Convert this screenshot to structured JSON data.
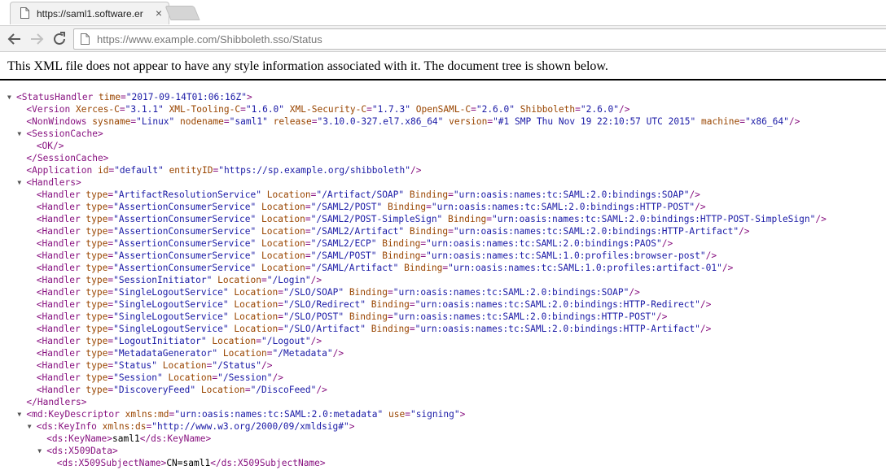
{
  "browser": {
    "tab_title": "https://saml1.software.er",
    "tab_close_glyph": "×",
    "url": "https://www.example.com/Shibboleth.sso/Status"
  },
  "notice": "This XML file does not appear to have any style information associated with it. The document tree is shown below.",
  "xml_lines": [
    {
      "indent": 0,
      "toggle": "open",
      "parts": [
        [
          "t",
          "<StatusHandler "
        ],
        [
          "n",
          "time"
        ],
        [
          "t",
          "="
        ],
        [
          "v",
          "\"2017-09-14T01:06:16Z\""
        ],
        [
          "t",
          ">"
        ]
      ]
    },
    {
      "indent": 1,
      "parts": [
        [
          "t",
          "<Version "
        ],
        [
          "n",
          "Xerces-C"
        ],
        [
          "t",
          "="
        ],
        [
          "v",
          "\"3.1.1\""
        ],
        [
          "x",
          " "
        ],
        [
          "n",
          "XML-Tooling-C"
        ],
        [
          "t",
          "="
        ],
        [
          "v",
          "\"1.6.0\""
        ],
        [
          "x",
          " "
        ],
        [
          "n",
          "XML-Security-C"
        ],
        [
          "t",
          "="
        ],
        [
          "v",
          "\"1.7.3\""
        ],
        [
          "x",
          " "
        ],
        [
          "n",
          "OpenSAML-C"
        ],
        [
          "t",
          "="
        ],
        [
          "v",
          "\"2.6.0\""
        ],
        [
          "x",
          " "
        ],
        [
          "n",
          "Shibboleth"
        ],
        [
          "t",
          "="
        ],
        [
          "v",
          "\"2.6.0\""
        ],
        [
          "t",
          "/>"
        ]
      ]
    },
    {
      "indent": 1,
      "parts": [
        [
          "t",
          "<NonWindows "
        ],
        [
          "n",
          "sysname"
        ],
        [
          "t",
          "="
        ],
        [
          "v",
          "\"Linux\""
        ],
        [
          "x",
          " "
        ],
        [
          "n",
          "nodename"
        ],
        [
          "t",
          "="
        ],
        [
          "v",
          "\"saml1\""
        ],
        [
          "x",
          " "
        ],
        [
          "n",
          "release"
        ],
        [
          "t",
          "="
        ],
        [
          "v",
          "\"3.10.0-327.el7.x86_64\""
        ],
        [
          "x",
          " "
        ],
        [
          "n",
          "version"
        ],
        [
          "t",
          "="
        ],
        [
          "v",
          "\"#1 SMP Thu Nov 19 22:10:57 UTC 2015\""
        ],
        [
          "x",
          " "
        ],
        [
          "n",
          "machine"
        ],
        [
          "t",
          "="
        ],
        [
          "v",
          "\"x86_64\""
        ],
        [
          "t",
          "/>"
        ]
      ]
    },
    {
      "indent": 1,
      "toggle": "open",
      "parts": [
        [
          "t",
          "<SessionCache>"
        ]
      ]
    },
    {
      "indent": 2,
      "parts": [
        [
          "t",
          "<OK/>"
        ]
      ]
    },
    {
      "indent": 1,
      "parts": [
        [
          "t",
          "</SessionCache>"
        ]
      ]
    },
    {
      "indent": 1,
      "parts": [
        [
          "t",
          "<Application "
        ],
        [
          "n",
          "id"
        ],
        [
          "t",
          "="
        ],
        [
          "v",
          "\"default\""
        ],
        [
          "x",
          " "
        ],
        [
          "n",
          "entityID"
        ],
        [
          "t",
          "="
        ],
        [
          "v",
          "\"https://sp.example.org/shibboleth\""
        ],
        [
          "t",
          "/>"
        ]
      ]
    },
    {
      "indent": 1,
      "toggle": "open",
      "parts": [
        [
          "t",
          "<Handlers>"
        ]
      ]
    },
    {
      "indent": 2,
      "parts": [
        [
          "t",
          "<Handler "
        ],
        [
          "n",
          "type"
        ],
        [
          "t",
          "="
        ],
        [
          "v",
          "\"ArtifactResolutionService\""
        ],
        [
          "x",
          " "
        ],
        [
          "n",
          "Location"
        ],
        [
          "t",
          "="
        ],
        [
          "v",
          "\"/Artifact/SOAP\""
        ],
        [
          "x",
          " "
        ],
        [
          "n",
          "Binding"
        ],
        [
          "t",
          "="
        ],
        [
          "v",
          "\"urn:oasis:names:tc:SAML:2.0:bindings:SOAP\""
        ],
        [
          "t",
          "/>"
        ]
      ]
    },
    {
      "indent": 2,
      "parts": [
        [
          "t",
          "<Handler "
        ],
        [
          "n",
          "type"
        ],
        [
          "t",
          "="
        ],
        [
          "v",
          "\"AssertionConsumerService\""
        ],
        [
          "x",
          " "
        ],
        [
          "n",
          "Location"
        ],
        [
          "t",
          "="
        ],
        [
          "v",
          "\"/SAML2/POST\""
        ],
        [
          "x",
          " "
        ],
        [
          "n",
          "Binding"
        ],
        [
          "t",
          "="
        ],
        [
          "v",
          "\"urn:oasis:names:tc:SAML:2.0:bindings:HTTP-POST\""
        ],
        [
          "t",
          "/>"
        ]
      ]
    },
    {
      "indent": 2,
      "parts": [
        [
          "t",
          "<Handler "
        ],
        [
          "n",
          "type"
        ],
        [
          "t",
          "="
        ],
        [
          "v",
          "\"AssertionConsumerService\""
        ],
        [
          "x",
          " "
        ],
        [
          "n",
          "Location"
        ],
        [
          "t",
          "="
        ],
        [
          "v",
          "\"/SAML2/POST-SimpleSign\""
        ],
        [
          "x",
          " "
        ],
        [
          "n",
          "Binding"
        ],
        [
          "t",
          "="
        ],
        [
          "v",
          "\"urn:oasis:names:tc:SAML:2.0:bindings:HTTP-POST-SimpleSign\""
        ],
        [
          "t",
          "/>"
        ]
      ]
    },
    {
      "indent": 2,
      "parts": [
        [
          "t",
          "<Handler "
        ],
        [
          "n",
          "type"
        ],
        [
          "t",
          "="
        ],
        [
          "v",
          "\"AssertionConsumerService\""
        ],
        [
          "x",
          " "
        ],
        [
          "n",
          "Location"
        ],
        [
          "t",
          "="
        ],
        [
          "v",
          "\"/SAML2/Artifact\""
        ],
        [
          "x",
          " "
        ],
        [
          "n",
          "Binding"
        ],
        [
          "t",
          "="
        ],
        [
          "v",
          "\"urn:oasis:names:tc:SAML:2.0:bindings:HTTP-Artifact\""
        ],
        [
          "t",
          "/>"
        ]
      ]
    },
    {
      "indent": 2,
      "parts": [
        [
          "t",
          "<Handler "
        ],
        [
          "n",
          "type"
        ],
        [
          "t",
          "="
        ],
        [
          "v",
          "\"AssertionConsumerService\""
        ],
        [
          "x",
          " "
        ],
        [
          "n",
          "Location"
        ],
        [
          "t",
          "="
        ],
        [
          "v",
          "\"/SAML2/ECP\""
        ],
        [
          "x",
          " "
        ],
        [
          "n",
          "Binding"
        ],
        [
          "t",
          "="
        ],
        [
          "v",
          "\"urn:oasis:names:tc:SAML:2.0:bindings:PAOS\""
        ],
        [
          "t",
          "/>"
        ]
      ]
    },
    {
      "indent": 2,
      "parts": [
        [
          "t",
          "<Handler "
        ],
        [
          "n",
          "type"
        ],
        [
          "t",
          "="
        ],
        [
          "v",
          "\"AssertionConsumerService\""
        ],
        [
          "x",
          " "
        ],
        [
          "n",
          "Location"
        ],
        [
          "t",
          "="
        ],
        [
          "v",
          "\"/SAML/POST\""
        ],
        [
          "x",
          " "
        ],
        [
          "n",
          "Binding"
        ],
        [
          "t",
          "="
        ],
        [
          "v",
          "\"urn:oasis:names:tc:SAML:1.0:profiles:browser-post\""
        ],
        [
          "t",
          "/>"
        ]
      ]
    },
    {
      "indent": 2,
      "parts": [
        [
          "t",
          "<Handler "
        ],
        [
          "n",
          "type"
        ],
        [
          "t",
          "="
        ],
        [
          "v",
          "\"AssertionConsumerService\""
        ],
        [
          "x",
          " "
        ],
        [
          "n",
          "Location"
        ],
        [
          "t",
          "="
        ],
        [
          "v",
          "\"/SAML/Artifact\""
        ],
        [
          "x",
          " "
        ],
        [
          "n",
          "Binding"
        ],
        [
          "t",
          "="
        ],
        [
          "v",
          "\"urn:oasis:names:tc:SAML:1.0:profiles:artifact-01\""
        ],
        [
          "t",
          "/>"
        ]
      ]
    },
    {
      "indent": 2,
      "parts": [
        [
          "t",
          "<Handler "
        ],
        [
          "n",
          "type"
        ],
        [
          "t",
          "="
        ],
        [
          "v",
          "\"SessionInitiator\""
        ],
        [
          "x",
          " "
        ],
        [
          "n",
          "Location"
        ],
        [
          "t",
          "="
        ],
        [
          "v",
          "\"/Login\""
        ],
        [
          "t",
          "/>"
        ]
      ]
    },
    {
      "indent": 2,
      "parts": [
        [
          "t",
          "<Handler "
        ],
        [
          "n",
          "type"
        ],
        [
          "t",
          "="
        ],
        [
          "v",
          "\"SingleLogoutService\""
        ],
        [
          "x",
          " "
        ],
        [
          "n",
          "Location"
        ],
        [
          "t",
          "="
        ],
        [
          "v",
          "\"/SLO/SOAP\""
        ],
        [
          "x",
          " "
        ],
        [
          "n",
          "Binding"
        ],
        [
          "t",
          "="
        ],
        [
          "v",
          "\"urn:oasis:names:tc:SAML:2.0:bindings:SOAP\""
        ],
        [
          "t",
          "/>"
        ]
      ]
    },
    {
      "indent": 2,
      "parts": [
        [
          "t",
          "<Handler "
        ],
        [
          "n",
          "type"
        ],
        [
          "t",
          "="
        ],
        [
          "v",
          "\"SingleLogoutService\""
        ],
        [
          "x",
          " "
        ],
        [
          "n",
          "Location"
        ],
        [
          "t",
          "="
        ],
        [
          "v",
          "\"/SLO/Redirect\""
        ],
        [
          "x",
          " "
        ],
        [
          "n",
          "Binding"
        ],
        [
          "t",
          "="
        ],
        [
          "v",
          "\"urn:oasis:names:tc:SAML:2.0:bindings:HTTP-Redirect\""
        ],
        [
          "t",
          "/>"
        ]
      ]
    },
    {
      "indent": 2,
      "parts": [
        [
          "t",
          "<Handler "
        ],
        [
          "n",
          "type"
        ],
        [
          "t",
          "="
        ],
        [
          "v",
          "\"SingleLogoutService\""
        ],
        [
          "x",
          " "
        ],
        [
          "n",
          "Location"
        ],
        [
          "t",
          "="
        ],
        [
          "v",
          "\"/SLO/POST\""
        ],
        [
          "x",
          " "
        ],
        [
          "n",
          "Binding"
        ],
        [
          "t",
          "="
        ],
        [
          "v",
          "\"urn:oasis:names:tc:SAML:2.0:bindings:HTTP-POST\""
        ],
        [
          "t",
          "/>"
        ]
      ]
    },
    {
      "indent": 2,
      "parts": [
        [
          "t",
          "<Handler "
        ],
        [
          "n",
          "type"
        ],
        [
          "t",
          "="
        ],
        [
          "v",
          "\"SingleLogoutService\""
        ],
        [
          "x",
          " "
        ],
        [
          "n",
          "Location"
        ],
        [
          "t",
          "="
        ],
        [
          "v",
          "\"/SLO/Artifact\""
        ],
        [
          "x",
          " "
        ],
        [
          "n",
          "Binding"
        ],
        [
          "t",
          "="
        ],
        [
          "v",
          "\"urn:oasis:names:tc:SAML:2.0:bindings:HTTP-Artifact\""
        ],
        [
          "t",
          "/>"
        ]
      ]
    },
    {
      "indent": 2,
      "parts": [
        [
          "t",
          "<Handler "
        ],
        [
          "n",
          "type"
        ],
        [
          "t",
          "="
        ],
        [
          "v",
          "\"LogoutInitiator\""
        ],
        [
          "x",
          " "
        ],
        [
          "n",
          "Location"
        ],
        [
          "t",
          "="
        ],
        [
          "v",
          "\"/Logout\""
        ],
        [
          "t",
          "/>"
        ]
      ]
    },
    {
      "indent": 2,
      "parts": [
        [
          "t",
          "<Handler "
        ],
        [
          "n",
          "type"
        ],
        [
          "t",
          "="
        ],
        [
          "v",
          "\"MetadataGenerator\""
        ],
        [
          "x",
          " "
        ],
        [
          "n",
          "Location"
        ],
        [
          "t",
          "="
        ],
        [
          "v",
          "\"/Metadata\""
        ],
        [
          "t",
          "/>"
        ]
      ]
    },
    {
      "indent": 2,
      "parts": [
        [
          "t",
          "<Handler "
        ],
        [
          "n",
          "type"
        ],
        [
          "t",
          "="
        ],
        [
          "v",
          "\"Status\""
        ],
        [
          "x",
          " "
        ],
        [
          "n",
          "Location"
        ],
        [
          "t",
          "="
        ],
        [
          "v",
          "\"/Status\""
        ],
        [
          "t",
          "/>"
        ]
      ]
    },
    {
      "indent": 2,
      "parts": [
        [
          "t",
          "<Handler "
        ],
        [
          "n",
          "type"
        ],
        [
          "t",
          "="
        ],
        [
          "v",
          "\"Session\""
        ],
        [
          "x",
          " "
        ],
        [
          "n",
          "Location"
        ],
        [
          "t",
          "="
        ],
        [
          "v",
          "\"/Session\""
        ],
        [
          "t",
          "/>"
        ]
      ]
    },
    {
      "indent": 2,
      "parts": [
        [
          "t",
          "<Handler "
        ],
        [
          "n",
          "type"
        ],
        [
          "t",
          "="
        ],
        [
          "v",
          "\"DiscoveryFeed\""
        ],
        [
          "x",
          " "
        ],
        [
          "n",
          "Location"
        ],
        [
          "t",
          "="
        ],
        [
          "v",
          "\"/DiscoFeed\""
        ],
        [
          "t",
          "/>"
        ]
      ]
    },
    {
      "indent": 1,
      "parts": [
        [
          "t",
          "</Handlers>"
        ]
      ]
    },
    {
      "indent": 1,
      "toggle": "open",
      "parts": [
        [
          "t",
          "<md:KeyDescriptor "
        ],
        [
          "n",
          "xmlns:md"
        ],
        [
          "t",
          "="
        ],
        [
          "v",
          "\"urn:oasis:names:tc:SAML:2.0:metadata\""
        ],
        [
          "x",
          " "
        ],
        [
          "n",
          "use"
        ],
        [
          "t",
          "="
        ],
        [
          "v",
          "\"signing\""
        ],
        [
          "t",
          ">"
        ]
      ]
    },
    {
      "indent": 2,
      "toggle": "open",
      "parts": [
        [
          "t",
          "<ds:KeyInfo "
        ],
        [
          "n",
          "xmlns:ds"
        ],
        [
          "t",
          "="
        ],
        [
          "v",
          "\"http://www.w3.org/2000/09/xmldsig#\""
        ],
        [
          "t",
          ">"
        ]
      ]
    },
    {
      "indent": 3,
      "parts": [
        [
          "t",
          "<ds:KeyName>"
        ],
        [
          "x",
          "saml1"
        ],
        [
          "t",
          "</ds:KeyName>"
        ]
      ]
    },
    {
      "indent": 3,
      "toggle": "open",
      "parts": [
        [
          "t",
          "<ds:X509Data>"
        ]
      ]
    },
    {
      "indent": 4,
      "parts": [
        [
          "t",
          "<ds:X509SubjectName>"
        ],
        [
          "x",
          "CN=saml1"
        ],
        [
          "t",
          "</ds:X509SubjectName>"
        ]
      ]
    }
  ]
}
